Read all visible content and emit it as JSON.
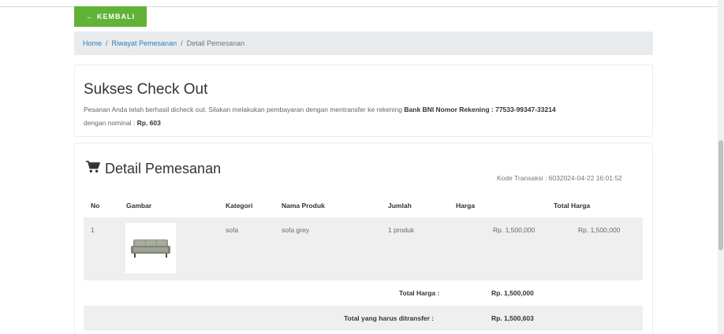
{
  "nav": {
    "back_label": "KEMBALI"
  },
  "breadcrumb": {
    "home": "Home",
    "history": "Riwayat Pemesanan",
    "current": "Detail Pemesanan"
  },
  "success": {
    "title": "Sukses Check Out",
    "message": "Pesanan Anda telah berhasil dicheck out. Silakan melakukan pembayaran dengan mentransfer ke rekening",
    "bank_info": "Bank BNI Nomor Rekening : 77533-99347-33214",
    "nominal_label": "dengan nominal :",
    "nominal_value": "Rp. 603"
  },
  "detail": {
    "title": "Detail Pemesanan",
    "kode_transaksi": "Kode Transaksi : 6032024-04-22 16:01:52",
    "headers": {
      "no": "No",
      "gambar": "Gambar",
      "kategori": "Kategori",
      "nama_produk": "Nama Produk",
      "jumlah": "Jumlah",
      "harga": "Harga",
      "total_harga": "Total Harga"
    },
    "rows": [
      {
        "no": "1",
        "kategori": "sofa",
        "nama_produk": "sofa grey",
        "jumlah": "1 produk",
        "harga": "Rp. 1,500,000",
        "total_harga": "Rp. 1,500,000",
        "image_icon": "sofa-image"
      }
    ],
    "total_label": "Total Harga :",
    "total_value": "Rp. 1,500,000",
    "transfer_label": "Total yang harus ditransfer :",
    "transfer_value": "Rp. 1,500,603"
  },
  "colors": {
    "accent": "#5fb336",
    "link": "#337ab7"
  }
}
